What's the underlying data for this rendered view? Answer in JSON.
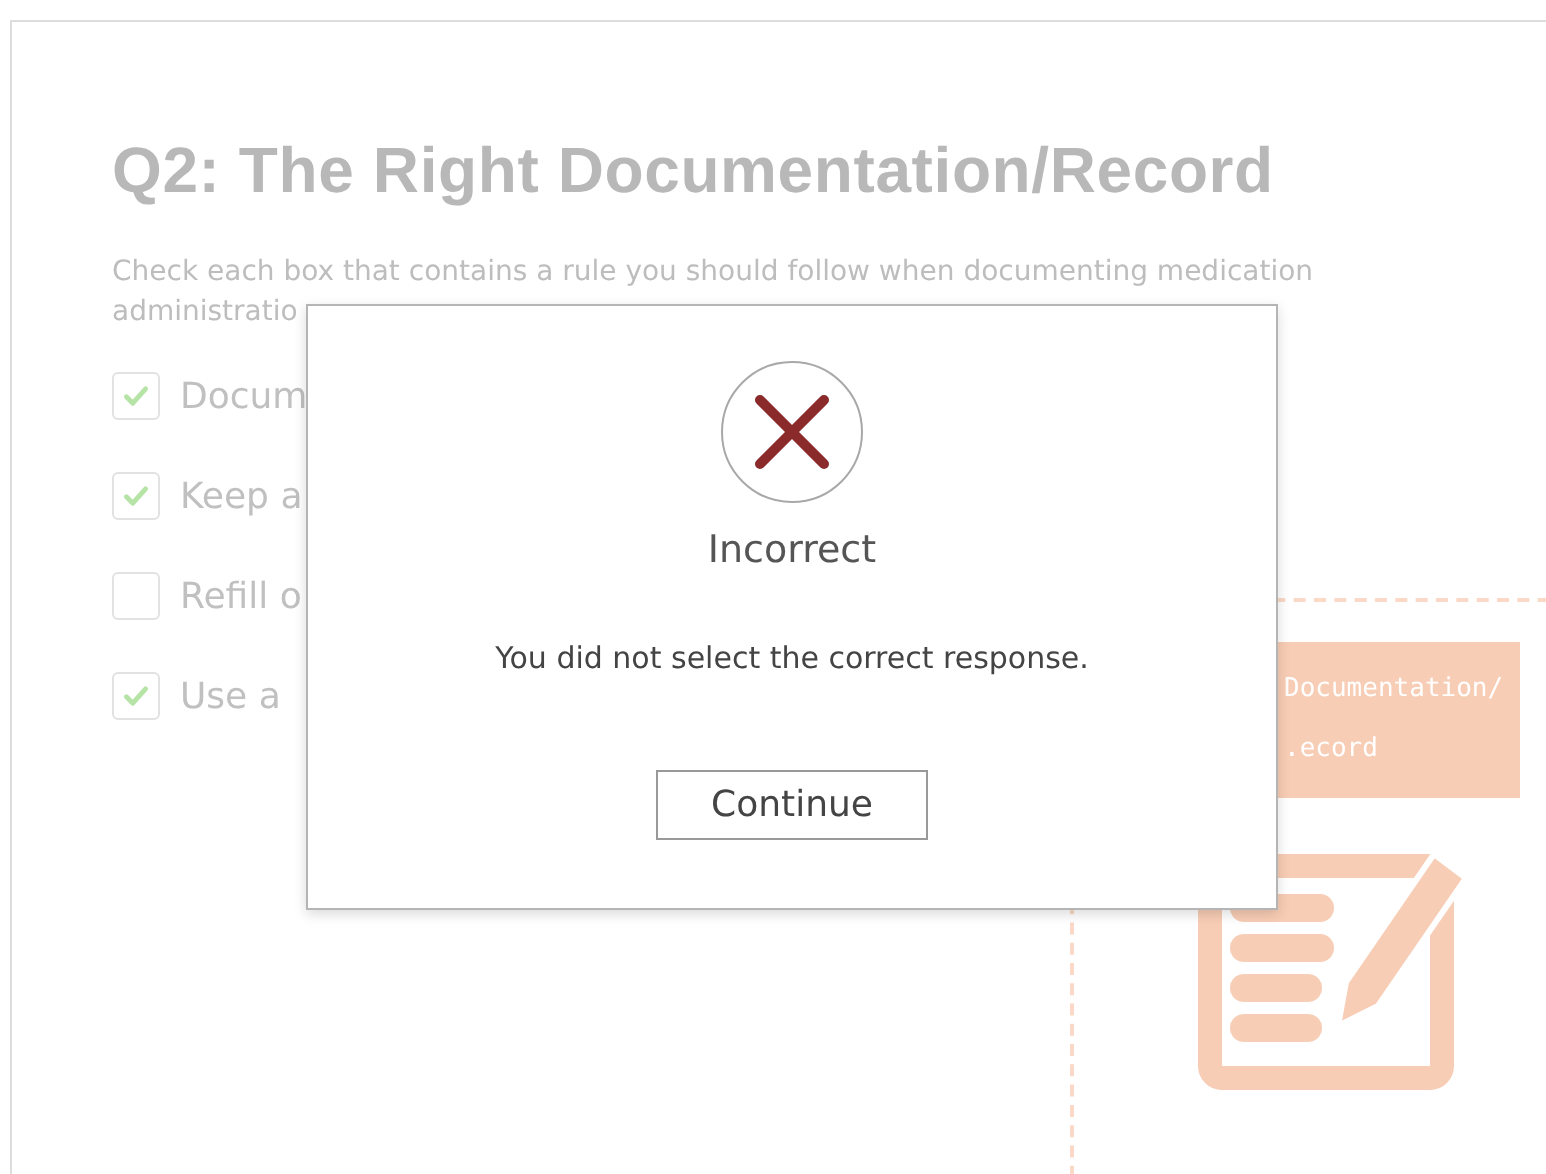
{
  "slide": {
    "title": "Q2: The Right Documentation/Record",
    "instructions": [
      "Check each box that contains a rule you should follow when documenting medication",
      "administratio"
    ],
    "options": [
      {
        "label": "Docum",
        "checked": true
      },
      {
        "label": "Keep a",
        "checked": true
      },
      {
        "label": "Refill o",
        "checked": false
      },
      {
        "label": "Use a",
        "checked": true
      }
    ],
    "card": {
      "heading": [
        "Documentation/",
        ".ecord"
      ]
    }
  },
  "dialog": {
    "title": "Incorrect",
    "message": "You did not select the correct response.",
    "button": "Continue"
  }
}
